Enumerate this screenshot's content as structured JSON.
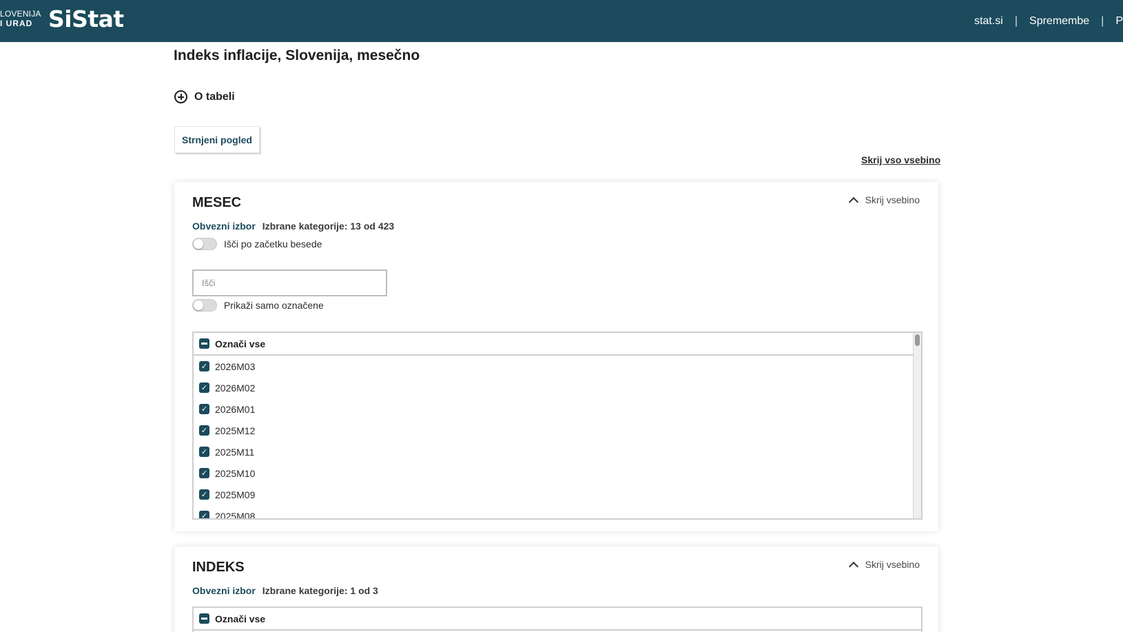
{
  "header": {
    "logo_line1": "LOVENIJA",
    "logo_line2": "I URAD",
    "brand": "SiStat",
    "nav": [
      "stat.si",
      "Spremembe",
      "P"
    ],
    "color": "#1b4b5c"
  },
  "page": {
    "title": "Indeks inflacije, Slovenija, mesečno",
    "about_label": "O tabeli",
    "compact_button": "Strnjeni pogled",
    "hide_all_label": "Skrij vso vsebino"
  },
  "panels": [
    {
      "title": "MESEC",
      "toggle_label": "Skrij vsebino",
      "required_label": "Obvezni izbor",
      "selected_label": "Izbrane kategorije: 13 od 423",
      "switch_search_label": "Išči po začetku besede",
      "search_placeholder": "Išči",
      "switch_selected_label": "Prikaži samo označene",
      "select_all_label": "Označi vse",
      "items": [
        "2026M03",
        "2026M02",
        "2026M01",
        "2025M12",
        "2025M11",
        "2025M10",
        "2025M09",
        "2025M08"
      ]
    },
    {
      "title": "INDEKS",
      "toggle_label": "Skrij vsebino",
      "required_label": "Obvezni izbor",
      "selected_label": "Izbrane kategorije: 1 od 3",
      "select_all_label": "Označi vse"
    }
  ],
  "icons": {
    "about": "plus-circle-icon",
    "toggle": "chevron-up-icon",
    "select_all": "checkbox-indeterminate-icon",
    "item": "checkbox-checked-icon"
  }
}
